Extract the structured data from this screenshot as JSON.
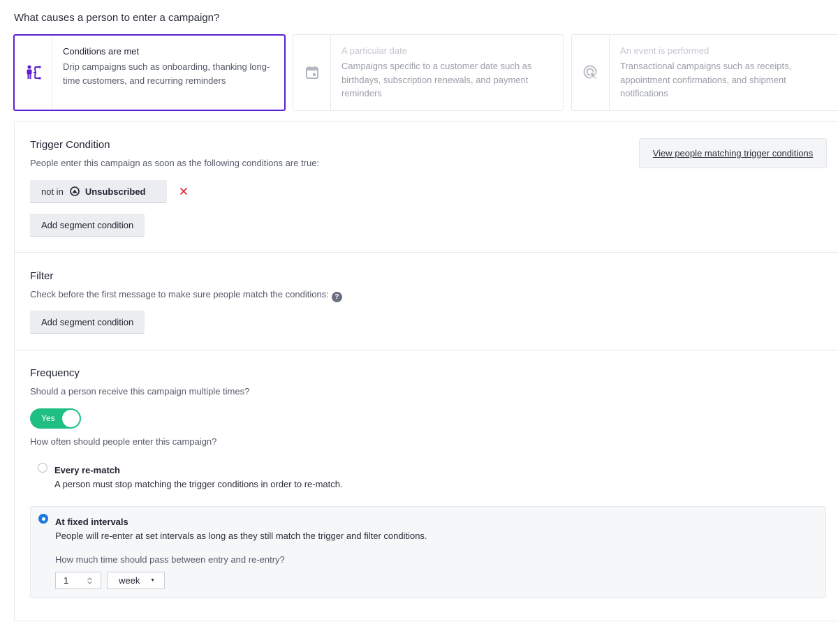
{
  "question": "What causes a person to enter a campaign?",
  "trigger_types": [
    {
      "title": "Conditions are met",
      "description": "Drip campaigns such as onboarding, thanking long-time customers, and recurring reminders",
      "icon": "person-branch-icon",
      "selected": true
    },
    {
      "title": "A particular date",
      "description": "Campaigns specific to a customer date such as birthdays, subscription renewals, and payment reminders",
      "icon": "calendar-icon",
      "selected": false
    },
    {
      "title": "An event is performed",
      "description": "Transactional campaigns such as receipts, appointment confirmations, and shipment notifications",
      "icon": "cursor-click-icon",
      "selected": false
    }
  ],
  "trigger_condition": {
    "title": "Trigger Condition",
    "subtitle": "People enter this campaign as soon as the following conditions are true:",
    "view_button": "View people matching trigger conditions",
    "condition": {
      "operator": "not in",
      "segment": "Unsubscribed"
    },
    "add_button": "Add segment condition"
  },
  "filter": {
    "title": "Filter",
    "subtitle": "Check before the first message to make sure people match the conditions:",
    "help": "?",
    "add_button": "Add segment condition"
  },
  "frequency": {
    "title": "Frequency",
    "subtitle": "Should a person receive this campaign multiple times?",
    "toggle_label": "Yes",
    "how_often": "How often should people enter this campaign?",
    "options": [
      {
        "title": "Every re-match",
        "description": "A person must stop matching the trigger conditions in order to re-match.",
        "checked": false
      },
      {
        "title": "At fixed intervals",
        "description": "People will re-enter at set intervals as long as they still match the trigger and filter conditions.",
        "checked": true
      }
    ],
    "interval_question": "How much time should pass between entry and re-entry?",
    "interval_value": "1",
    "interval_unit": "week"
  },
  "colors": {
    "accent": "#5b1fd1",
    "toggle": "#1fbf83",
    "radio": "#1d7be0",
    "remove": "#d9263a"
  }
}
